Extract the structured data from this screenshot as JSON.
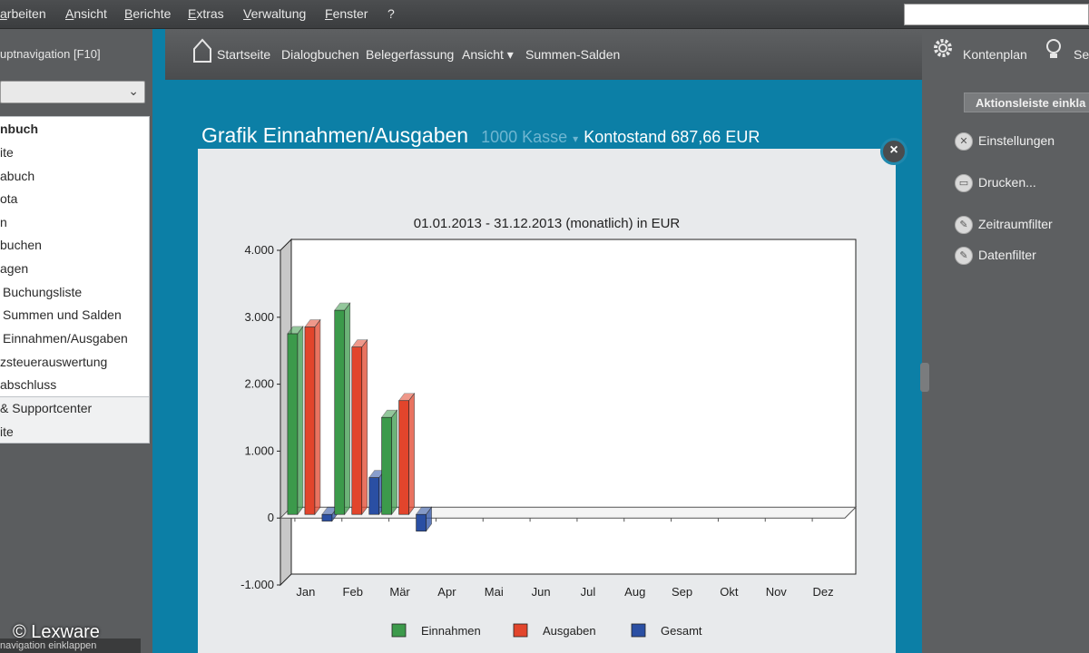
{
  "menu": {
    "items": [
      "arbeiten",
      "Ansicht",
      "Berichte",
      "Extras",
      "Verwaltung",
      "Fenster",
      "?"
    ]
  },
  "nav": {
    "header": "uptnavigation [F10]",
    "tree": [
      "nbuch",
      "ite",
      "abuch",
      "ota",
      "n",
      "buchen",
      "agen",
      "Buchungsliste",
      "Summen und Salden",
      "Einnahmen/Ausgaben",
      "zsteuerauswertung",
      "abschluss"
    ],
    "sub": [
      "& Supportcenter",
      "ite"
    ],
    "collapse": "navigation einklappen"
  },
  "toolbar": {
    "items": [
      "Startseite",
      "Dialogbuchen",
      "Belegerfassung",
      "Ansicht ▾",
      "Summen-Salden"
    ],
    "right": [
      "Kontenplan",
      "Se"
    ]
  },
  "title": {
    "main": "Grafik Einnahmen/Ausgaben",
    "account": "1000 Kasse",
    "separator": "▾",
    "balance": "Kontostand 687,66 EUR"
  },
  "actions": {
    "collapse": "Aktionsleiste einkla",
    "items": [
      {
        "label": "Einstellungen",
        "icon": "tools-icon"
      },
      {
        "label": "Drucken...",
        "icon": "print-icon"
      },
      {
        "label": "Zeitraumfilter",
        "icon": "pencil-icon"
      },
      {
        "label": "Datenfilter",
        "icon": "pencil-icon"
      }
    ]
  },
  "watermark": "© Lexware",
  "colors": {
    "einnahmen": "#3c9a4b",
    "ausgaben": "#e2452c",
    "gesamt": "#2a4fa3"
  },
  "chart_data": {
    "type": "bar",
    "title": "01.01.2013 - 31.12.2013 (monatlich) in EUR",
    "categories": [
      "Jan",
      "Feb",
      "Mär",
      "Apr",
      "Mai",
      "Jun",
      "Jul",
      "Aug",
      "Sep",
      "Okt",
      "Nov",
      "Dez"
    ],
    "series": [
      {
        "name": "Einnahmen",
        "values": [
          2700,
          3050,
          1450,
          0,
          0,
          0,
          0,
          0,
          0,
          0,
          0,
          0
        ]
      },
      {
        "name": "Ausgaben",
        "values": [
          2800,
          2500,
          1700,
          0,
          0,
          0,
          0,
          0,
          0,
          0,
          0,
          0
        ]
      },
      {
        "name": "Gesamt",
        "values": [
          -100,
          550,
          -250,
          0,
          0,
          0,
          0,
          0,
          0,
          0,
          0,
          0
        ]
      }
    ],
    "ylim": [
      -1000,
      4000
    ],
    "yticks": [
      "4.000",
      "3.000",
      "2.000",
      "1.000",
      "0",
      "-1.000"
    ],
    "legend": "bottom"
  }
}
